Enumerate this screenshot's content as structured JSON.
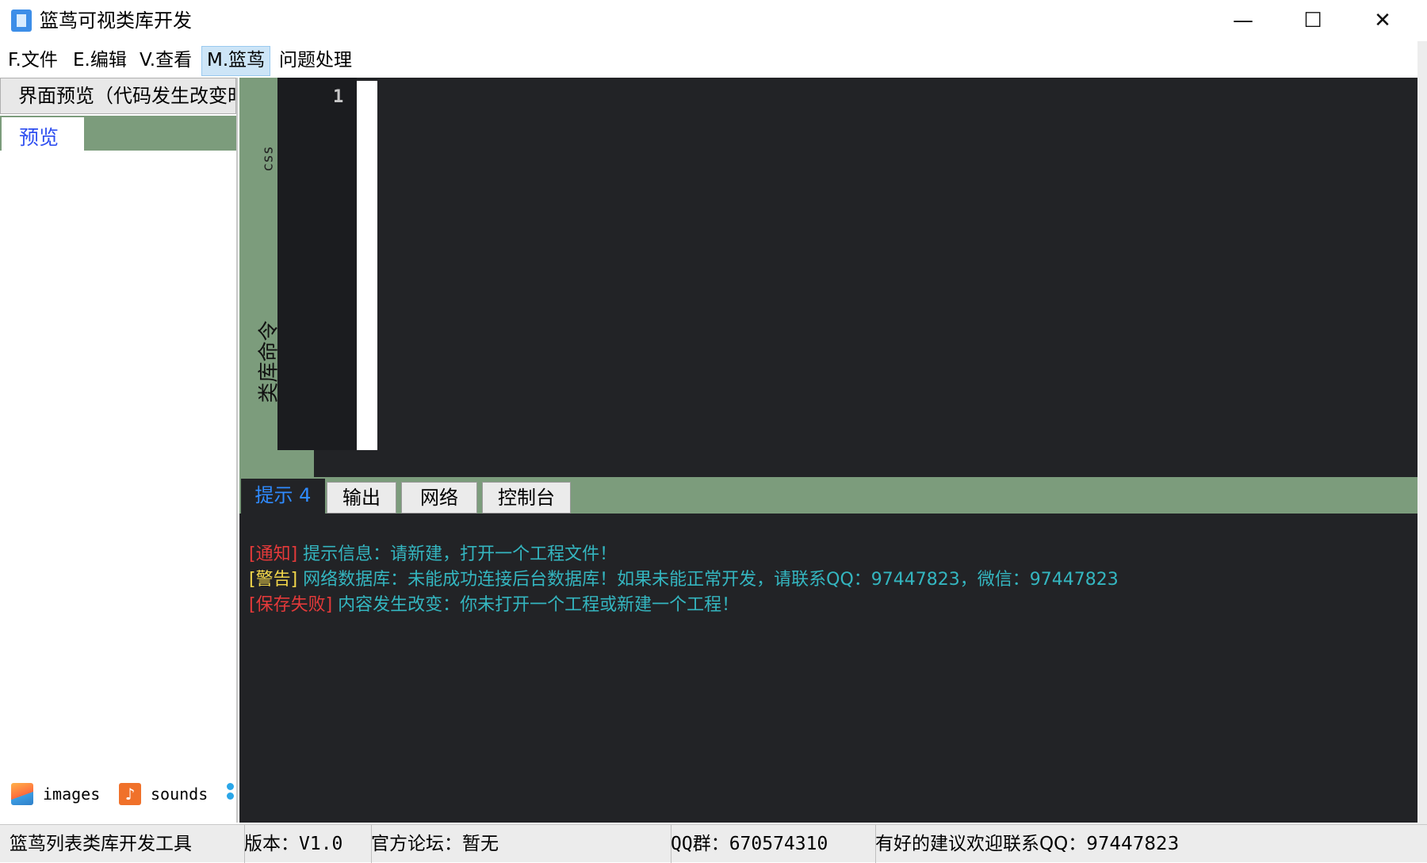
{
  "window": {
    "title": "篮茑可视类库开发",
    "icon": "app-document-icon",
    "controls": {
      "minimize": "—",
      "maximize": "☐",
      "close": "✕"
    }
  },
  "menu": {
    "items": [
      {
        "label": "F.文件"
      },
      {
        "label": "E.编辑"
      },
      {
        "label": "V.查看"
      },
      {
        "label": "M.篮茑",
        "active": true
      },
      {
        "label": "问题处理"
      }
    ]
  },
  "left_panel": {
    "header": "界面预览（代码发生改变时",
    "tab": "预览",
    "assets": [
      {
        "label": "images",
        "icon": "image-icon"
      },
      {
        "label": "sounds",
        "icon": "music-note-icon"
      }
    ]
  },
  "editor": {
    "side_tabs": [
      "css",
      "类库命令"
    ],
    "line_number": "1"
  },
  "bottom_tabs": {
    "tabs": [
      "提示 4",
      "输出",
      "网络",
      "控制台"
    ],
    "active": "提示 4"
  },
  "console": {
    "messages": [
      {
        "tag": "[通知]",
        "text": "提示信息：请新建，打开一个工程文件！",
        "tag_color": "#e43a3a"
      },
      {
        "tag": "[警告]",
        "text": "网络数据库：未能成功连接后台数据库！如果未能正常开发，请联系QQ：97447823，微信：97447823",
        "tag_color": "#f2d64a"
      },
      {
        "tag": "[保存失败]",
        "text": "内容发生改变：你未打开一个工程或新建一个工程！",
        "tag_color": "#e43a3a"
      }
    ]
  },
  "status_bar": {
    "tool": "篮茑列表类库开发工具",
    "version": "版本：V1.0",
    "forum": "官方论坛：暂无",
    "qq_group": "QQ群：670574310",
    "suggest": "有好的建议欢迎联系QQ：97447823"
  },
  "colors": {
    "accent_green": "#7c9c7c",
    "editor_bg": "#222326",
    "message_text": "#34b6c0",
    "active_tab_text": "#2f8bff"
  }
}
